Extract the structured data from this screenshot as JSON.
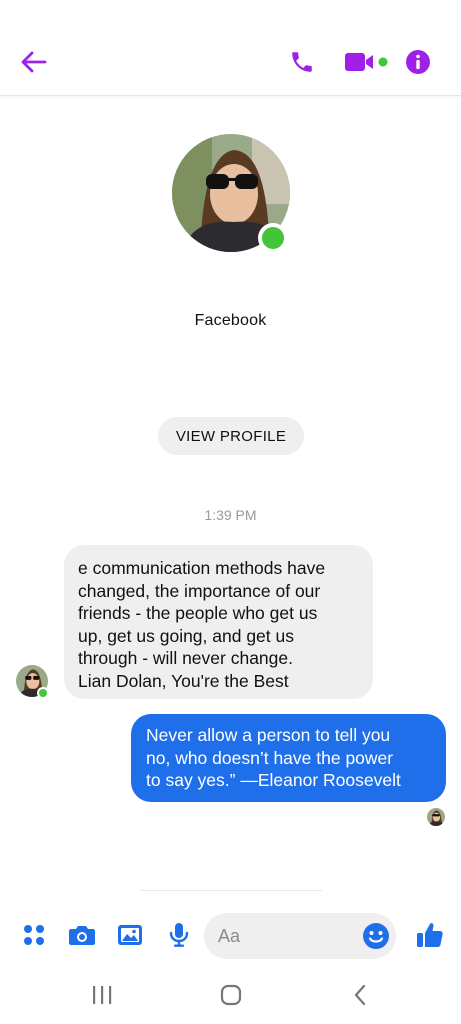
{
  "colors": {
    "accent_purple": "#a020e8",
    "messenger_blue": "#1f6feb",
    "online_green": "#44c43a",
    "bubble_gray": "#efefef"
  },
  "header": {
    "icons": [
      "back-arrow-icon",
      "phone-icon",
      "video-camera-icon",
      "info-icon"
    ]
  },
  "contact": {
    "name": "Facebook",
    "online": true,
    "view_profile_label": "VIEW PROFILE"
  },
  "conversation": {
    "timestamp": "1:39 PM",
    "messages": [
      {
        "direction": "incoming",
        "lines": [
          "e communication methods have",
          "changed, the importance of our",
          "friends - the people who get us",
          "up, get us going, and get us",
          "through - will never change.",
          "Lian Dolan, You're the Best"
        ]
      },
      {
        "direction": "outgoing",
        "lines": [
          "Never allow a person to tell you",
          "no, who doesn’t have the power",
          "to say yes.” —Eleanor Roosevelt"
        ]
      }
    ]
  },
  "composer": {
    "placeholder": "Aa",
    "icons": [
      "menu-dots-icon",
      "camera-icon",
      "gallery-icon",
      "microphone-icon",
      "emoji-icon",
      "thumbs-up-icon"
    ]
  },
  "system_nav": {
    "icons": [
      "recent-apps-icon",
      "home-icon",
      "back-icon"
    ]
  }
}
